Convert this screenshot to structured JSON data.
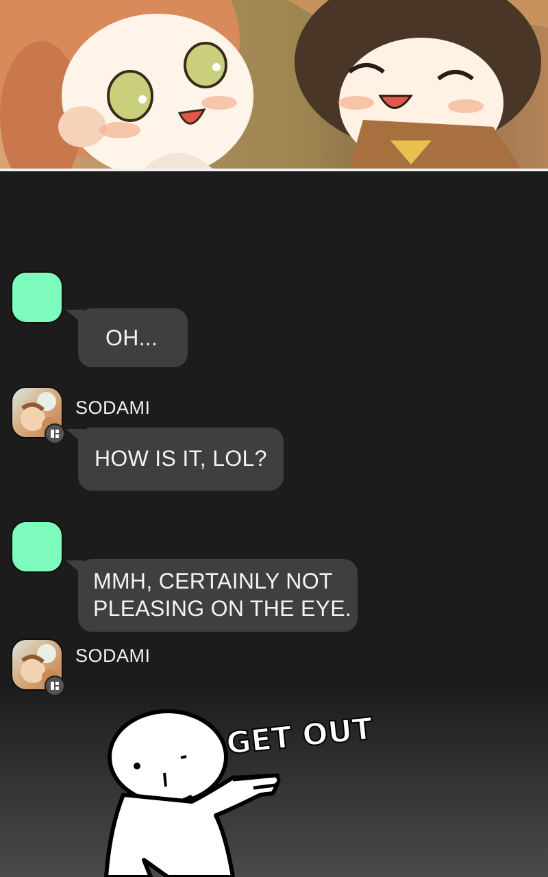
{
  "messages": [
    {
      "sender": "",
      "avatar_icon": "mint-avatar-icon",
      "text": "OH..."
    },
    {
      "sender": "SODAMI",
      "avatar_icon": "sodami-avatar-icon",
      "text": "HOW IS IT, LOL?"
    },
    {
      "sender": "",
      "avatar_icon": "mint-avatar-icon",
      "text_lines": [
        "MMH, CERTAINLY NOT",
        "PLEASING ON THE EYE."
      ]
    },
    {
      "sender": "SODAMI",
      "avatar_icon": "sodami-avatar-icon"
    }
  ],
  "doodle": {
    "text": "GET OUT",
    "icon": "stick-figure-pointing-icon"
  },
  "colors": {
    "background": "#1c1c1c",
    "bubble": "#3f3f3f",
    "mint_avatar": "#7dfcbe"
  }
}
